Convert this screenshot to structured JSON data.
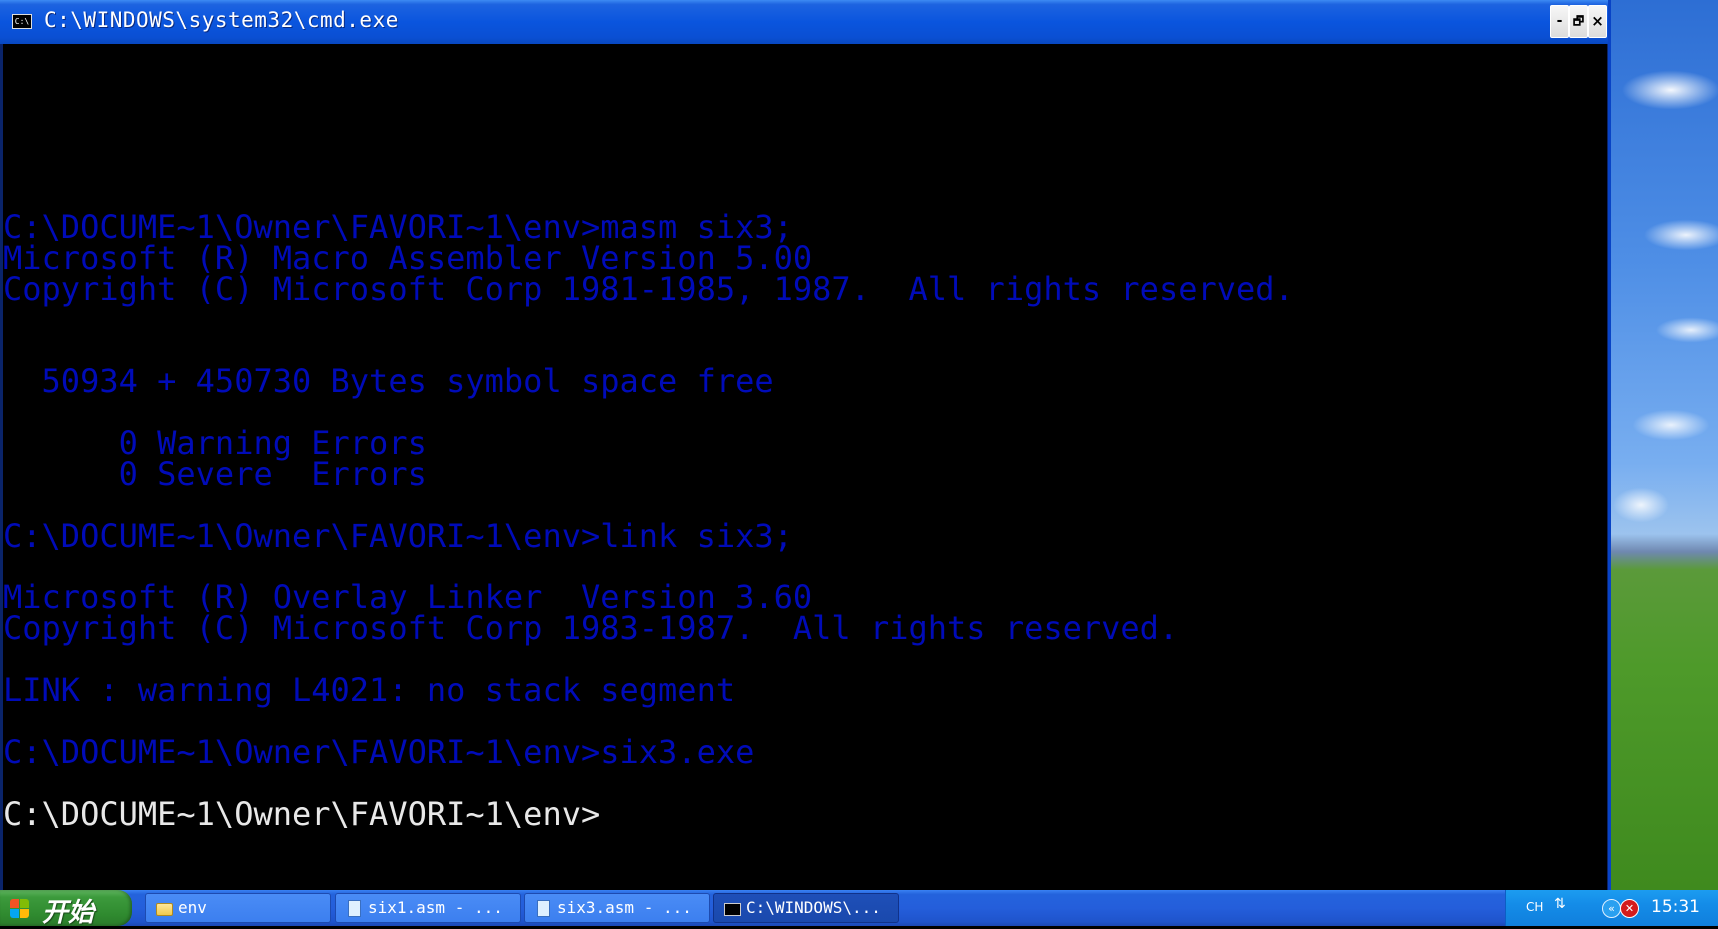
{
  "window": {
    "title": "C:\\WINDOWS\\system32\\cmd.exe",
    "icon_text": "C:\\",
    "buttons": {
      "minimize": "-",
      "restore": "🗗",
      "close": "×"
    }
  },
  "console": {
    "lines": [
      "C:\\DOCUME~1\\Owner\\FAVORI~1\\env>masm six3;",
      "Microsoft (R) Macro Assembler Version 5.00",
      "Copyright (C) Microsoft Corp 1981-1985, 1987.  All rights reserved.",
      "  50934 + 450730 Bytes symbol space free",
      "      0 Warning Errors",
      "      0 Severe  Errors",
      "C:\\DOCUME~1\\Owner\\FAVORI~1\\env>link six3;",
      "Microsoft (R) Overlay Linker  Version 3.60",
      "Copyright (C) Microsoft Corp 1983-1987.  All rights reserved.",
      "LINK : warning L4021: no stack segment",
      "C:\\DOCUME~1\\Owner\\FAVORI~1\\env>six3.exe",
      "C:\\DOCUME~1\\Owner\\FAVORI~1\\env>"
    ],
    "colors": {
      "text": "#000bb8",
      "prompt_current": "#e8e8e8",
      "background": "#000000"
    }
  },
  "taskbar": {
    "start_label": "开始",
    "tasks": [
      {
        "label": "env",
        "icon": "folder-icon",
        "active": false
      },
      {
        "label": "six1.asm - ...",
        "icon": "document-icon",
        "active": false
      },
      {
        "label": "six3.asm - ...",
        "icon": "document-icon",
        "active": false
      },
      {
        "label": "C:\\WINDOWS\\...",
        "icon": "cmd-icon",
        "active": true
      }
    ],
    "tray": {
      "language": "CH",
      "clock": "15:31"
    }
  }
}
